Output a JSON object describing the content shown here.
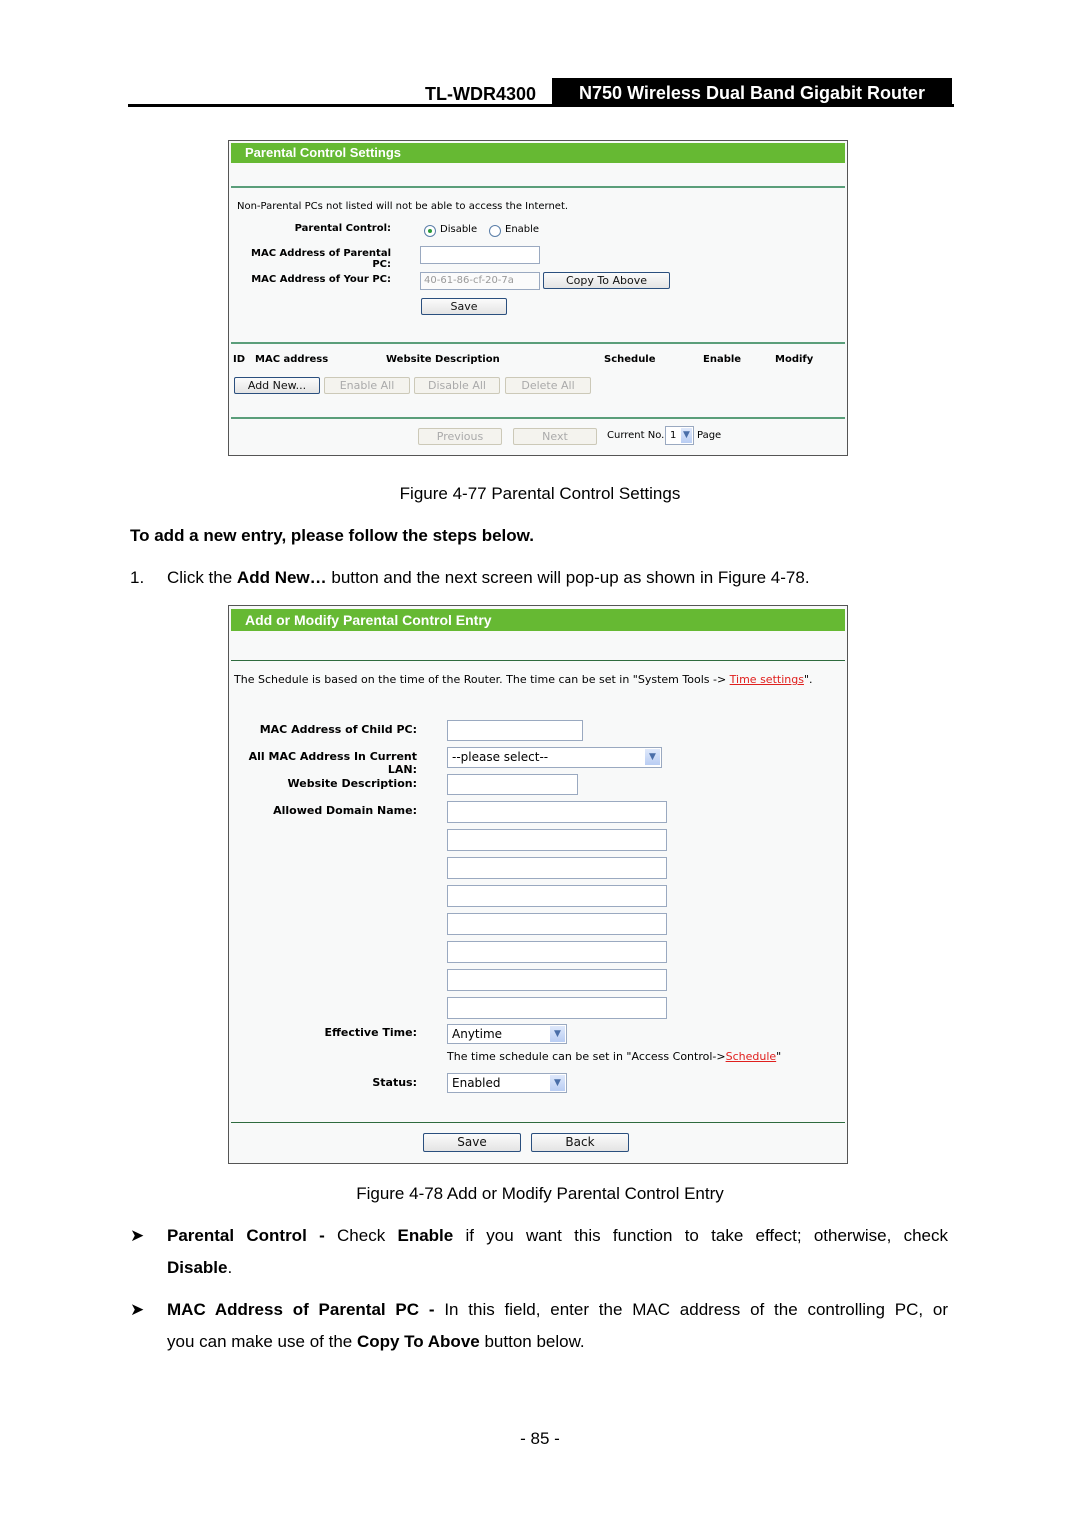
{
  "header": {
    "model": "TL-WDR4300",
    "product": "N750 Wireless Dual Band Gigabit Router"
  },
  "fig77": {
    "title": "Parental Control Settings",
    "notice": "Non-Parental PCs not listed will not be able to access the Internet.",
    "parental_control_label": "Parental Control:",
    "radio_disable": "Disable",
    "radio_enable": "Enable",
    "selected": "Disable",
    "mac_parental_label": "MAC Address of Parental PC:",
    "mac_parental_value": "",
    "mac_your_label": "MAC Address of Your PC:",
    "mac_your_value": "40-61-86-cf-20-7a",
    "copy_button": "Copy To Above",
    "save_button": "Save",
    "table_headers": [
      "ID",
      "MAC address",
      "Website Description",
      "Schedule",
      "Enable",
      "Modify"
    ],
    "add_new_button": "Add New...",
    "enable_all_button": "Enable All",
    "disable_all_button": "Disable All",
    "delete_all_button": "Delete All",
    "previous_button": "Previous",
    "next_button": "Next",
    "current_no_label": "Current No.",
    "current_page": "1",
    "page_label": "Page",
    "caption": "Figure 4-77 Parental Control Settings"
  },
  "steps_heading": "To add a new entry, please follow the steps below.",
  "step1": {
    "num": "1.",
    "pre": "Click the ",
    "bold": "Add New…",
    "post": " button and the next screen will pop-up as shown in Figure 4-78."
  },
  "fig78": {
    "title": "Add or Modify Parental Control Entry",
    "schedule_note_pre": "The Schedule is based on the time of the Router. The time can be set in \"System Tools -> ",
    "schedule_note_link": "Time settings",
    "schedule_note_post": "\".",
    "mac_child_label": "MAC Address of Child PC:",
    "all_mac_label": "All MAC Address In Current LAN:",
    "all_mac_value": "--please select--",
    "website_desc_label": "Website Description:",
    "allowed_domain_label": "Allowed Domain Name:",
    "domain_fields": [
      "",
      "",
      "",
      "",
      "",
      "",
      "",
      ""
    ],
    "effective_time_label": "Effective Time:",
    "effective_time_value": "Anytime",
    "time_note_pre": "The time schedule can be set in \"Access Control->",
    "time_note_link": "Schedule",
    "time_note_post": "\"",
    "status_label": "Status:",
    "status_value": "Enabled",
    "save_button": "Save",
    "back_button": "Back",
    "caption": "Figure 4-78 Add or Modify Parental Control Entry"
  },
  "bullets": [
    {
      "bold": "Parental Control - ",
      "t1": "Check ",
      "b2": "Enable",
      "t2": " if you want this function to take effect; otherwise, check",
      "b3": "Disable",
      "t3": "."
    },
    {
      "bold": "MAC Address of Parental PC - ",
      "t1": "In this field, enter the MAC address of the controlling PC, or",
      "t2a": "you can make use of the ",
      "b2": "Copy To Above",
      "t2b": " button below."
    }
  ],
  "page_number": "- 85 -"
}
